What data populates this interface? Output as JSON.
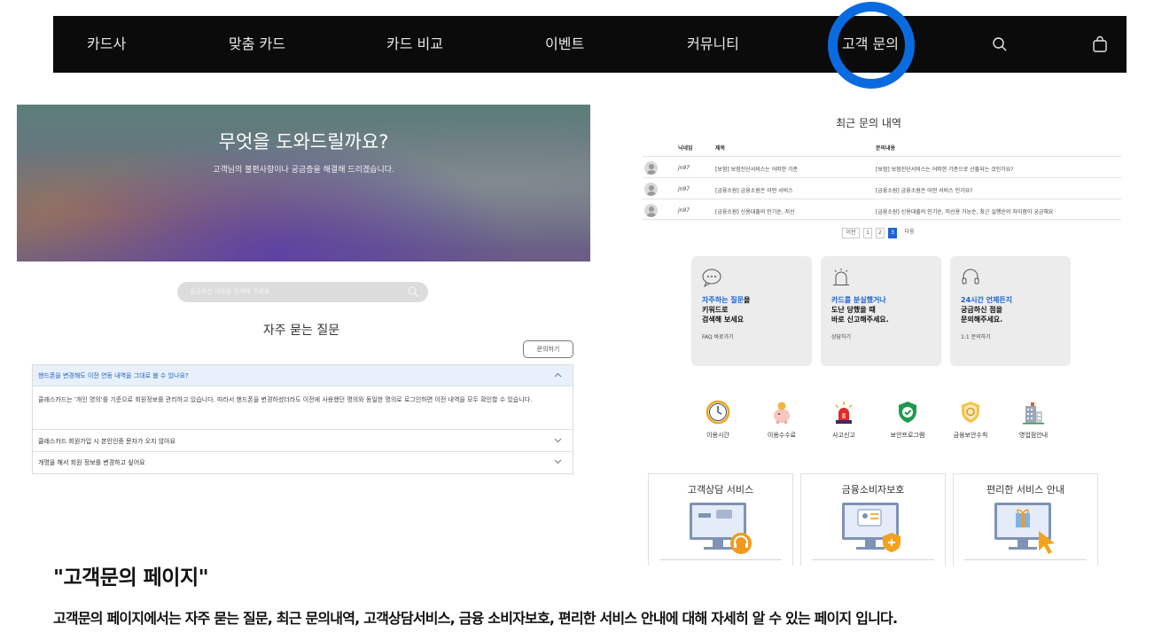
{
  "nav": {
    "items": [
      "카드사",
      "맞춤 카드",
      "카드 비교",
      "이벤트",
      "커뮤니티",
      "고객 문의"
    ],
    "icons": [
      "search-icon",
      "shopping-bag-icon"
    ],
    "highlight_color": "#0a6be0"
  },
  "hero": {
    "title": "무엇을 도와드릴까요?",
    "subtitle": "고객님의 불편사항이나 궁금증을 해결해 드리겠습니다."
  },
  "search": {
    "placeholder": "궁금하신 내용을 검색해 주세요."
  },
  "faq": {
    "title": "자주 묻는 질문",
    "ask_button": "문의하기",
    "items": [
      {
        "question": "핸드폰을 변경해도 이전 연동 내역을 그대로 볼 수 있나요?",
        "answer": "클래스카드는 '개인 명의'를 기준으로 회원정보를 관리하고 있습니다. 따라서 핸드폰을 변경하셨더라도 이전에 사용했던 명의와 동일한 명의로 로그인하면 이전 내역을 모두 확인할 수 있습니다.",
        "expanded": true
      },
      {
        "question": "클래스카드 회원가입 시 본인인증 문자가 오지 않아요",
        "expanded": false
      },
      {
        "question": "개명을 해서 회원 정보를 변경하고 싶어요",
        "expanded": false
      }
    ]
  },
  "recent": {
    "title": "최근 문의 내역",
    "headers": [
      "닉네임",
      "제목",
      "문의내용"
    ],
    "rows": [
      {
        "nickname": "jn97",
        "subject": "[보험] 보험진단서비스는 어떠한 기준",
        "content": "[보험] 보험진단서비스는 어떠한 기준으로 산출되는 것인가요?"
      },
      {
        "nickname": "jn97",
        "subject": "[금융소원] 금융소원은 어떤 서비스",
        "content": "[금융소원] 금융소원은 어떤 서비스 인가요?"
      },
      {
        "nickname": "jn97",
        "subject": "[금융소원] 신용대출의 인기순, 저신",
        "content": "[금융소원] 신용대출의 인기순, 저신용 가능순, 최근 실행순의 차이점이 궁금해요"
      }
    ],
    "pagination": {
      "prev": "이전",
      "pages": [
        "1",
        "2",
        "3"
      ],
      "current": "3",
      "next": "다음"
    }
  },
  "cards": [
    {
      "icon": "chat-bubble-icon",
      "highlight": "자주하는 질문",
      "rest_first": "을",
      "lines": [
        "키워드로",
        "검색해 보세요"
      ],
      "link": "FAQ 바로가기"
    },
    {
      "icon": "alarm-bell-icon",
      "highlight": "카드를 분실했거나",
      "rest_first": "",
      "lines": [
        "도난 당했을 때",
        "바로 신고해주세요."
      ],
      "link": "상담하기"
    },
    {
      "icon": "headset-icon",
      "highlight": "24시간 언제든지",
      "rest_first": "",
      "lines": [
        "궁금하신 점을",
        "문의해주세요."
      ],
      "link": "1:1 문의하기"
    }
  ],
  "quick_icons": [
    {
      "icon": "clock-icon",
      "label": "이용시간"
    },
    {
      "icon": "piggy-bank-icon",
      "label": "이용수수료"
    },
    {
      "icon": "siren-icon",
      "label": "사고신고"
    },
    {
      "icon": "shield-check-icon",
      "label": "보안프로그램"
    },
    {
      "icon": "security-badge-icon",
      "label": "금융보안수칙"
    },
    {
      "icon": "building-icon",
      "label": "영업점안내"
    }
  ],
  "services": [
    {
      "title": "고객상담 서비스",
      "icon": "monitor-headset-icon"
    },
    {
      "title": "금융소비자보호",
      "icon": "monitor-shield-icon"
    },
    {
      "title": "편리한 서비스 안내",
      "icon": "monitor-gift-icon"
    }
  ],
  "caption": {
    "title": "\"고객문의 페이지\"",
    "text": "고객문의 페이지에서는 자주 묻는 질문, 최근 문의내역, 고객상담서비스, 금융 소비자보호, 편리한 서비스 안내에 대해 자세히 알 수 있는 페이지 입니다."
  }
}
